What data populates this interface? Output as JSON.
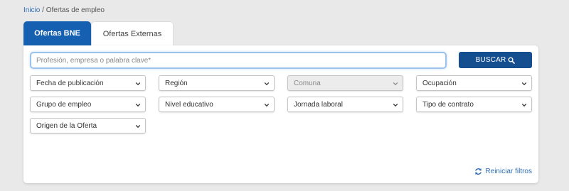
{
  "breadcrumb": {
    "home": "Inicio",
    "separator": "/",
    "current": "Ofertas de empleo"
  },
  "tabs": [
    {
      "label": "Ofertas BNE",
      "active": true
    },
    {
      "label": "Ofertas Externas",
      "active": false
    }
  ],
  "search": {
    "placeholder": "Profesión, empresa o palabra clave*",
    "value": "",
    "button_label": "BUSCAR"
  },
  "filters": [
    {
      "label": "Fecha de publicación",
      "disabled": false
    },
    {
      "label": "Región",
      "disabled": false
    },
    {
      "label": "Comuna",
      "disabled": true
    },
    {
      "label": "Ocupación",
      "disabled": false
    },
    {
      "label": "Grupo de empleo",
      "disabled": false
    },
    {
      "label": "Nivel educativo",
      "disabled": false
    },
    {
      "label": "Jornada laboral",
      "disabled": false
    },
    {
      "label": "Tipo de contrato",
      "disabled": false
    },
    {
      "label": "Origen de la Oferta",
      "disabled": false
    }
  ],
  "reset_label": "Reiniciar filtros",
  "colors": {
    "primary": "#1560b0",
    "button": "#154f8f",
    "link": "#2f6db5",
    "page_bg": "#e9e9e9"
  },
  "icons": {
    "search": "search-icon",
    "chevron": "chevron-down-icon",
    "reset": "refresh-icon"
  }
}
